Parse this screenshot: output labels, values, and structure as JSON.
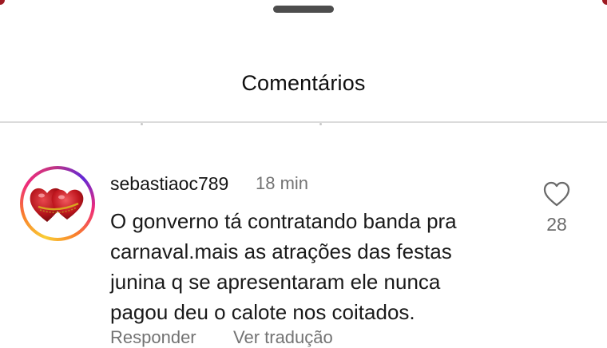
{
  "sheet": {
    "title": "Comentários"
  },
  "comment": {
    "username": "sebastiaoc789",
    "time": "18 min",
    "text_lines": [
      "O gonverno tá contratando banda pra",
      "carnaval.mais as atrações das festas",
      "junina q se apresentaram ele nunca",
      "pagou deu o calote nos coitados."
    ],
    "likes": "28",
    "reply_label": "Responder",
    "translate_label": "Ver tradução",
    "avatar_icon": "two-red-hearts-avatar",
    "like_icon": "heart-outline-icon"
  },
  "colors": {
    "ring_gradient": [
      "#f9ce34",
      "#ee2a7b",
      "#6228d7"
    ],
    "secondary_text": "#737373",
    "divider": "#dbdbdb",
    "handle": "#4d4d4d"
  }
}
